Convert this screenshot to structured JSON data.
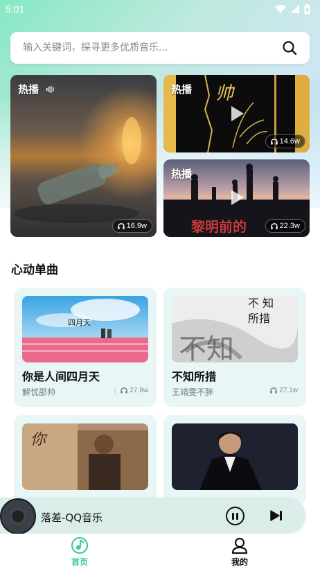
{
  "status_bar": {
    "time": "5:01"
  },
  "search": {
    "placeholder": "输入关键词，探寻更多优质音乐..."
  },
  "hot_cards": [
    {
      "label": "热播",
      "plays": "16.9w"
    },
    {
      "label": "热播",
      "plays": "14.6w"
    },
    {
      "label": "热播",
      "plays": "22.3w"
    }
  ],
  "section": {
    "title": "心动单曲"
  },
  "songs": [
    {
      "title": "你是人间四月天",
      "artist": "解忧邵帅",
      "plays": "27.8w"
    },
    {
      "title": "不知所措",
      "artist": "王靖雯不胖",
      "plays": "27.1w"
    },
    {
      "title": "",
      "artist": "",
      "plays": ""
    },
    {
      "title": "",
      "artist": "",
      "plays": ""
    }
  ],
  "now_playing": {
    "title": "落差-QQ音乐"
  },
  "tabs": [
    {
      "label": "首页",
      "active": true,
      "color": "#3ec9a7"
    },
    {
      "label": "我的",
      "active": false,
      "color": "#111111"
    }
  ],
  "colors": {
    "accent": "#3ec9a7",
    "card_bg": "#e8f6f6"
  }
}
